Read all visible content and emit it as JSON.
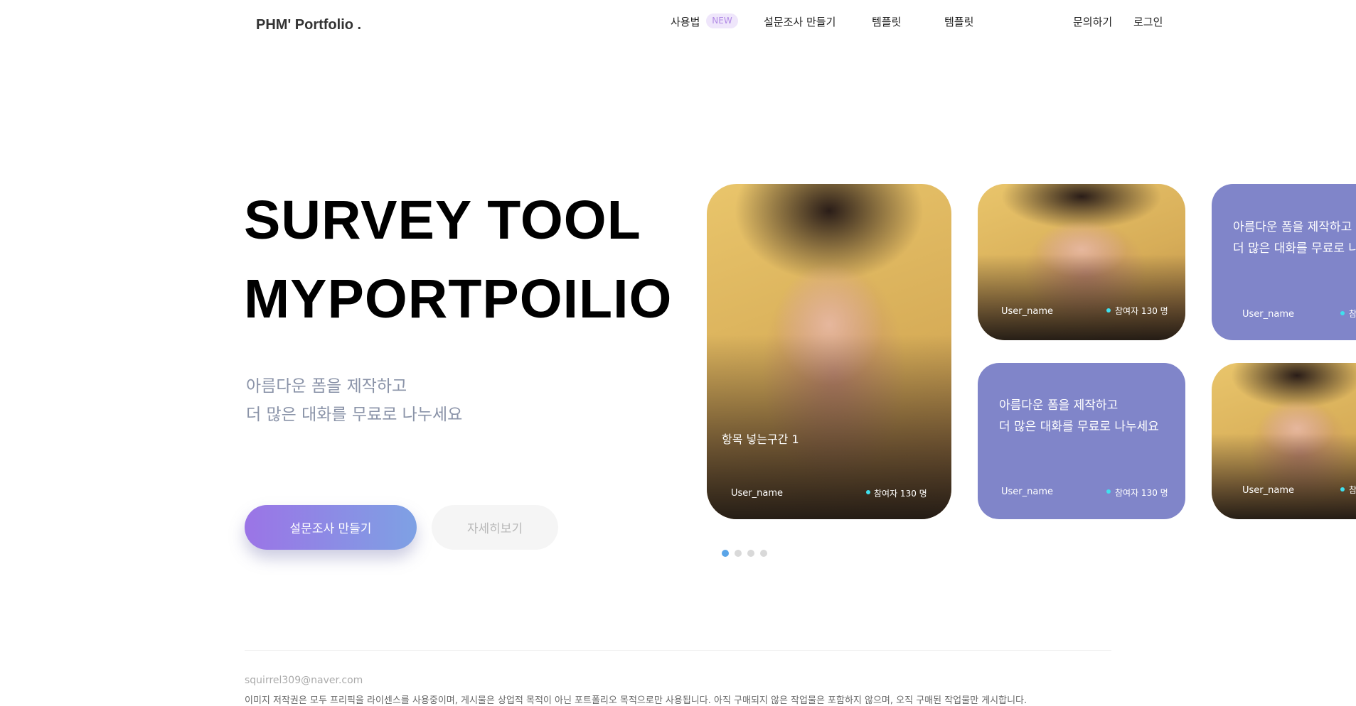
{
  "header": {
    "logo": "PHM' Portfolio .",
    "nav": {
      "usage": "사용법",
      "new_badge": "NEW",
      "create_survey": "설문조사 만들기",
      "template1": "템플릿",
      "template2": "템플릿",
      "contact": "문의하기",
      "login": "로그인"
    }
  },
  "hero": {
    "title_line1": "SURVEY TOOL",
    "title_line2": "MYPORTPOILIO",
    "subtitle_line1": "아름다운 폼을 제작하고",
    "subtitle_line2": "더 많은 대화를 무료로 나누세요",
    "primary_button": "설문조사 만들기",
    "secondary_button": "자세히보기"
  },
  "cards": {
    "main": {
      "caption": "항목 넣는구간 1",
      "user": "User_name",
      "participants": "참여자 130 명"
    },
    "top_middle": {
      "user": "User_name",
      "participants": "참여자 130 명"
    },
    "top_right": {
      "line1": "아름다운 폼을 제작하고",
      "line2": "더 많은 대화를 무료로 나",
      "user": "User_name",
      "participants": "참"
    },
    "bottom_middle": {
      "line1": "아름다운 폼을 제작하고",
      "line2": "더 많은 대화를 무료로 나누세요",
      "user": "User_name",
      "participants": "참여자 130 명"
    },
    "bottom_right": {
      "user": "User_name",
      "participants": "참"
    }
  },
  "pagination": {
    "total": 4,
    "active": 0
  },
  "footer": {
    "email": "squirrel309@naver.com",
    "disclaimer": "이미지 저작권은 모두 프리픽을 라이센스를 사용중이며, 게시물은 상업적 목적이 아닌 포트폴리오 목적으로만 사용됩니다. 아직 구매되지 않은 작업물은 포함하지 않으며, 오직 구매된 작업물만 게시합니다."
  },
  "colors": {
    "card_purple": "#8085c9",
    "button_gradient_start": "#9b74e6",
    "button_gradient_end": "#7ea1e4",
    "participant_dot": "#3fe0ee",
    "pagination_active": "#5aa5e8",
    "subtitle_text": "#8a93a8",
    "badge_bg": "#efe6fb",
    "badge_text": "#b28be6"
  }
}
